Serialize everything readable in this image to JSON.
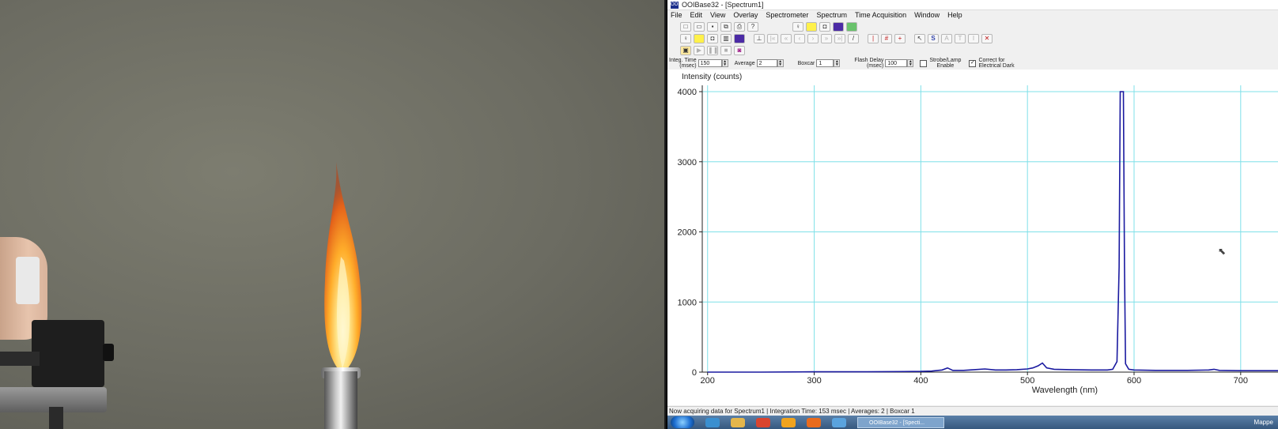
{
  "window": {
    "title": "OOIBase32 - [Spectrum1]",
    "app_icon": "OOI"
  },
  "menu": [
    "File",
    "Edit",
    "View",
    "Overlay",
    "Spectrometer",
    "Spectrum",
    "Time Acquisition",
    "Window",
    "Help"
  ],
  "controls": {
    "integ_time_label": "Integ. Time",
    "integ_time_unit": "(msec)",
    "integ_time_value": "150",
    "average_label": "Average",
    "average_value": "2",
    "boxcar_label": "Boxcar",
    "boxcar_value": "1",
    "flash_delay_label": "Flash Delay",
    "flash_delay_unit": "(msec)",
    "flash_delay_value": "100",
    "strobe_label_1": "Strobe/Lamp",
    "strobe_label_2": "Enable",
    "strobe_checked": false,
    "dark_label_1": "Correct for",
    "dark_label_2": "Electrical Dark",
    "dark_checked": true
  },
  "toolbar_icons": {
    "row1": [
      "new-icon",
      "open-icon",
      "save-icon",
      "copy-icon",
      "print-icon",
      "help-cursor-icon",
      "bulb-icon",
      "bulb-yellow-icon",
      "camera-icon",
      "purple-square-icon",
      "green-eye-icon"
    ],
    "row2": [
      "bulb-icon",
      "bulb-yellow-icon",
      "camera-icon",
      "chart-icon",
      "purple-square-icon",
      "scale-icon",
      "first-icon",
      "prev-fast-icon",
      "prev-icon",
      "next-icon",
      "next-fast-icon",
      "last-icon",
      "pen-icon",
      "cursor-left-icon",
      "grid-icon",
      "crosshair-icon",
      "pointer-icon",
      "s-mode-icon",
      "a-mode-icon",
      "t-mode-icon",
      "i-mode-icon",
      "stop-icon"
    ],
    "row3": [
      "acquire-icon",
      "play-icon",
      "pause-icon",
      "stop-square-icon",
      "snapshot-icon"
    ]
  },
  "status": "Now acquiring data for Spectrum1 | Integration Time: 153 msec | Averages: 2 | Boxcar 1",
  "taskbar": {
    "task_label": "OOIBase32 - [Specti...",
    "tray_text": "Mappe"
  },
  "colors": {
    "series": "#1a1aa0",
    "grid": "#7fe0e8"
  },
  "chart_data": {
    "type": "line",
    "title": "",
    "ylabel": "Intensity (counts)",
    "xlabel": "Wavelength (nm)",
    "xlim": [
      195,
      735
    ],
    "ylim": [
      0,
      4000
    ],
    "xticks": [
      200,
      300,
      400,
      500,
      600,
      700
    ],
    "yticks": [
      0,
      1000,
      2000,
      3000,
      4000
    ],
    "grid": true,
    "series": [
      {
        "x": [
          200,
          250,
          300,
          350,
          400,
          410,
          420,
          425,
          430,
          440,
          450,
          460,
          470,
          480,
          490,
          500,
          505,
          510,
          514,
          518,
          525,
          540,
          560,
          575,
          580,
          584,
          586,
          587,
          588,
          589,
          590,
          591,
          592,
          595,
          600,
          620,
          650,
          670,
          675,
          680,
          700,
          735
        ],
        "y": [
          0,
          0,
          5,
          5,
          10,
          15,
          30,
          60,
          25,
          25,
          35,
          45,
          30,
          30,
          35,
          45,
          60,
          90,
          130,
          60,
          40,
          35,
          30,
          30,
          40,
          150,
          1500,
          4000,
          4000,
          4000,
          4000,
          1500,
          120,
          40,
          30,
          25,
          25,
          30,
          40,
          25,
          20,
          20
        ]
      }
    ]
  }
}
